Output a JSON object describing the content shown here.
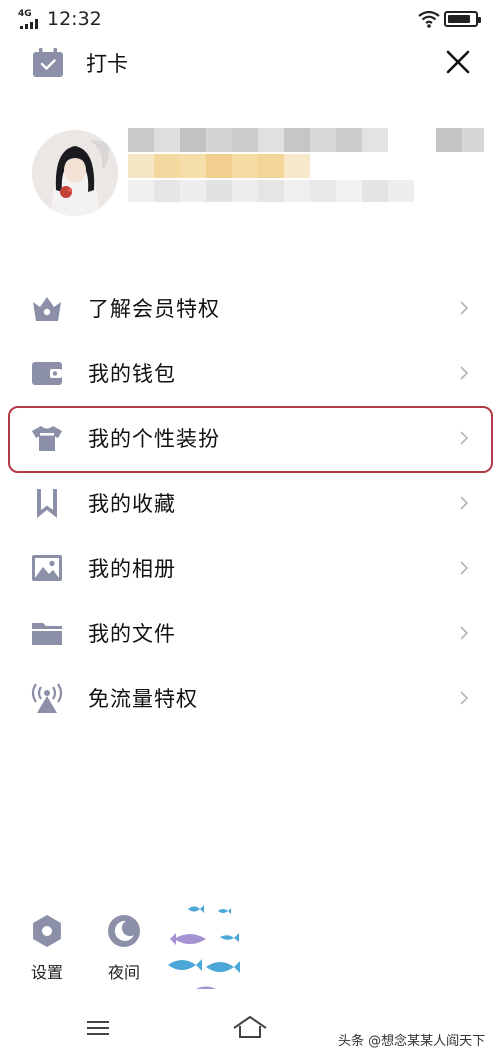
{
  "status_bar": {
    "network": "4G",
    "time": "12:32",
    "battery_level": 0.85
  },
  "header": {
    "checkin_label": "打卡"
  },
  "menu": {
    "items": [
      {
        "label": "了解会员特权",
        "icon": "vip-crown-icon"
      },
      {
        "label": "我的钱包",
        "icon": "wallet-icon"
      },
      {
        "label": "我的个性装扮",
        "icon": "tshirt-icon"
      },
      {
        "label": "我的收藏",
        "icon": "bookmark-icon"
      },
      {
        "label": "我的相册",
        "icon": "photo-icon"
      },
      {
        "label": "我的文件",
        "icon": "folder-icon"
      },
      {
        "label": "免流量特权",
        "icon": "signal-tower-icon"
      }
    ],
    "highlighted_index": 2
  },
  "bottom": {
    "settings_label": "设置",
    "night_label": "夜间"
  },
  "watermark": "头条 @想念某某人阎天下",
  "colors": {
    "icon": "#8c8fa8",
    "highlight": "#b23a46",
    "chevron": "#b5b5b5"
  }
}
